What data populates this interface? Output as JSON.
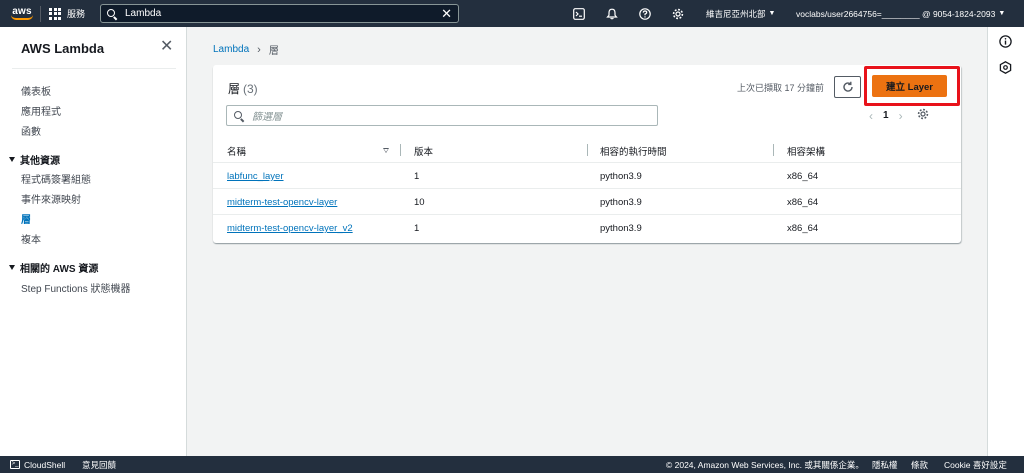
{
  "nav": {
    "logo_text": "aws",
    "services_label": "服務",
    "search_value": "Lambda",
    "region": "維吉尼亞州北部",
    "account": "voclabs/user2664756=________ @ 9054-1824-2093",
    "icons": [
      "cloudshell-icon",
      "bell-icon",
      "help-icon",
      "gear-icon"
    ]
  },
  "sidebar": {
    "title": "AWS Lambda",
    "items": [
      {
        "label": "儀表板"
      },
      {
        "label": "應用程式"
      },
      {
        "label": "函數"
      }
    ],
    "section1": {
      "label": "其他資源",
      "items": [
        {
          "label": "程式碼簽署組態"
        },
        {
          "label": "事件來源映射"
        },
        {
          "label": "層"
        },
        {
          "label": "複本"
        }
      ]
    },
    "section2": {
      "label": "相關的 AWS 資源",
      "items": [
        {
          "label": "Step Functions 狀態機器"
        }
      ]
    }
  },
  "breadcrumb": {
    "root": "Lambda",
    "current": "層"
  },
  "panel": {
    "title": "層",
    "count": "(3)",
    "fetched": "上次已擷取 17 分鐘前",
    "create_label": "建立 Layer",
    "filter_placeholder": "篩選層",
    "page": "1"
  },
  "table": {
    "headers": [
      "名稱",
      "版本",
      "相容的執行時間",
      "相容架構"
    ],
    "rows": [
      {
        "name": "labfunc_layer",
        "version": "1",
        "runtime": "python3.9",
        "arch": "x86_64"
      },
      {
        "name": "midterm-test-opencv-layer",
        "version": "10",
        "runtime": "python3.9",
        "arch": "x86_64"
      },
      {
        "name": "midterm-test-opencv-layer_v2",
        "version": "1",
        "runtime": "python3.9",
        "arch": "x86_64"
      }
    ]
  },
  "footer": {
    "cloudshell": "CloudShell",
    "feedback": "意見回饋",
    "copyright": "© 2024, Amazon Web Services, Inc. 或其關係企業。",
    "privacy": "隱私權",
    "terms": "條款",
    "cookie": "Cookie 喜好設定"
  },
  "colors": {
    "nav_bg": "#232f3e",
    "accent": "#ec7211",
    "link": "#0073bb",
    "highlight": "#e8121a"
  }
}
